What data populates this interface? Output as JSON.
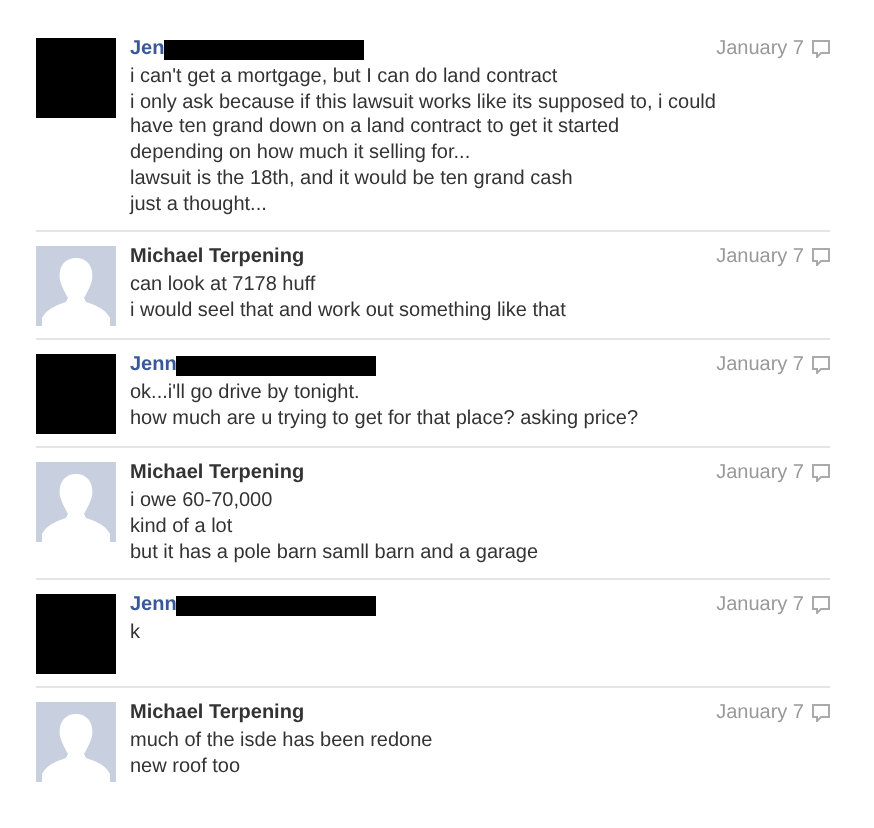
{
  "messages": [
    {
      "author": {
        "name": "Jen",
        "color": "#3b5998",
        "redacted": true
      },
      "date": "January 7",
      "lines": [
        "i can't get a mortgage, but I can do land contract",
        "i only ask because if this lawsuit works like its supposed to, i could have ten grand down on a land contract to get it started",
        "depending on how much it selling for...",
        "lawsuit is the 18th, and it would be ten grand cash",
        "just a thought..."
      ]
    },
    {
      "author": {
        "name": "Michael Terpening",
        "color": "#333333",
        "redacted": false
      },
      "date": "January 7",
      "lines": [
        "can look at 7178 huff",
        "i would seel that and work out something like that"
      ]
    },
    {
      "author": {
        "name": "Jenn",
        "color": "#3b5998",
        "redacted": true
      },
      "date": "January 7",
      "lines": [
        "ok...i'll go drive by tonight.",
        "how much are u trying to get for that place? asking price?"
      ]
    },
    {
      "author": {
        "name": "Michael Terpening",
        "color": "#333333",
        "redacted": false
      },
      "date": "January 7",
      "lines": [
        "i owe 60-70,000",
        "kind of a lot",
        "but it has a pole barn samll barn and a garage"
      ]
    },
    {
      "author": {
        "name": "Jenn",
        "color": "#3b5998",
        "redacted": true
      },
      "date": "January 7",
      "lines": [
        "k"
      ]
    },
    {
      "author": {
        "name": "Michael Terpening",
        "color": "#333333",
        "redacted": false
      },
      "date": "January 7",
      "lines": [
        "much of the isde has been redone",
        "new roof too"
      ]
    }
  ]
}
